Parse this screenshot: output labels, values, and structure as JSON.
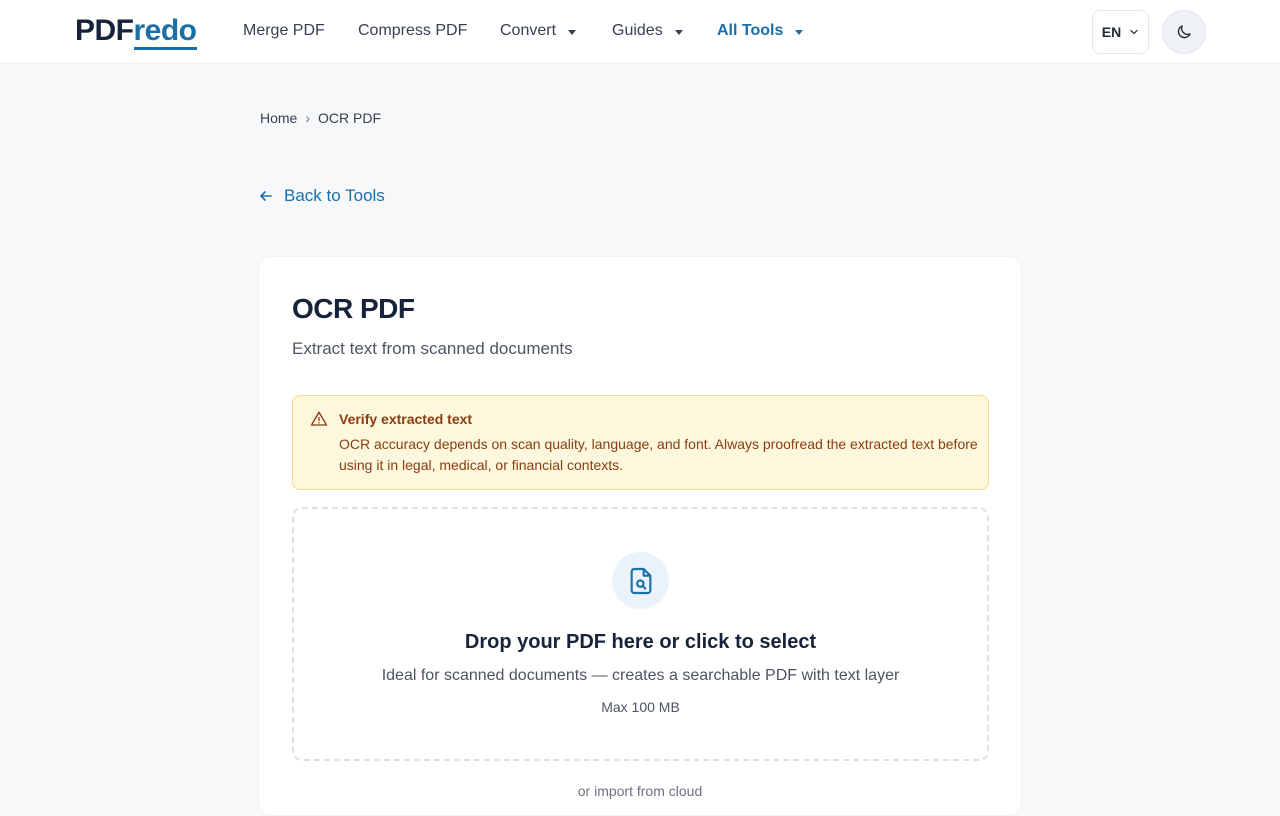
{
  "header": {
    "logo_pdf": "PDF",
    "logo_redo": "redo",
    "nav": [
      {
        "label": "Merge PDF"
      },
      {
        "label": "Compress PDF"
      },
      {
        "label": "Convert"
      },
      {
        "label": "Guides"
      },
      {
        "label": "All Tools"
      }
    ],
    "language": "EN"
  },
  "breadcrumb": {
    "home": "Home",
    "separator": "›",
    "current": "OCR PDF"
  },
  "back_link": "Back to Tools",
  "tool": {
    "title": "OCR PDF",
    "subtitle": "Extract text from scanned documents",
    "alert": {
      "title": "Verify extracted text",
      "body": "OCR accuracy depends on scan quality, language, and font. Always proofread the extracted text before using it in legal, medical, or financial contexts."
    },
    "dropzone": {
      "title": "Drop your PDF here or click to select",
      "subtitle": "Ideal for scanned documents — creates a searchable PDF with text layer",
      "max_size": "Max 100 MB"
    },
    "cloud_import": "or import from cloud"
  },
  "colors": {
    "brand": "#1a6fa8",
    "brand_dark": "#17233a",
    "warning_bg": "#fdf7dd",
    "warning_text": "#8a3d10"
  },
  "icons": {
    "language_chevron": "chevron-down-icon",
    "theme": "moon-icon",
    "back": "arrow-left-icon",
    "alert": "warning-triangle-icon",
    "dropzone": "file-search-icon"
  }
}
